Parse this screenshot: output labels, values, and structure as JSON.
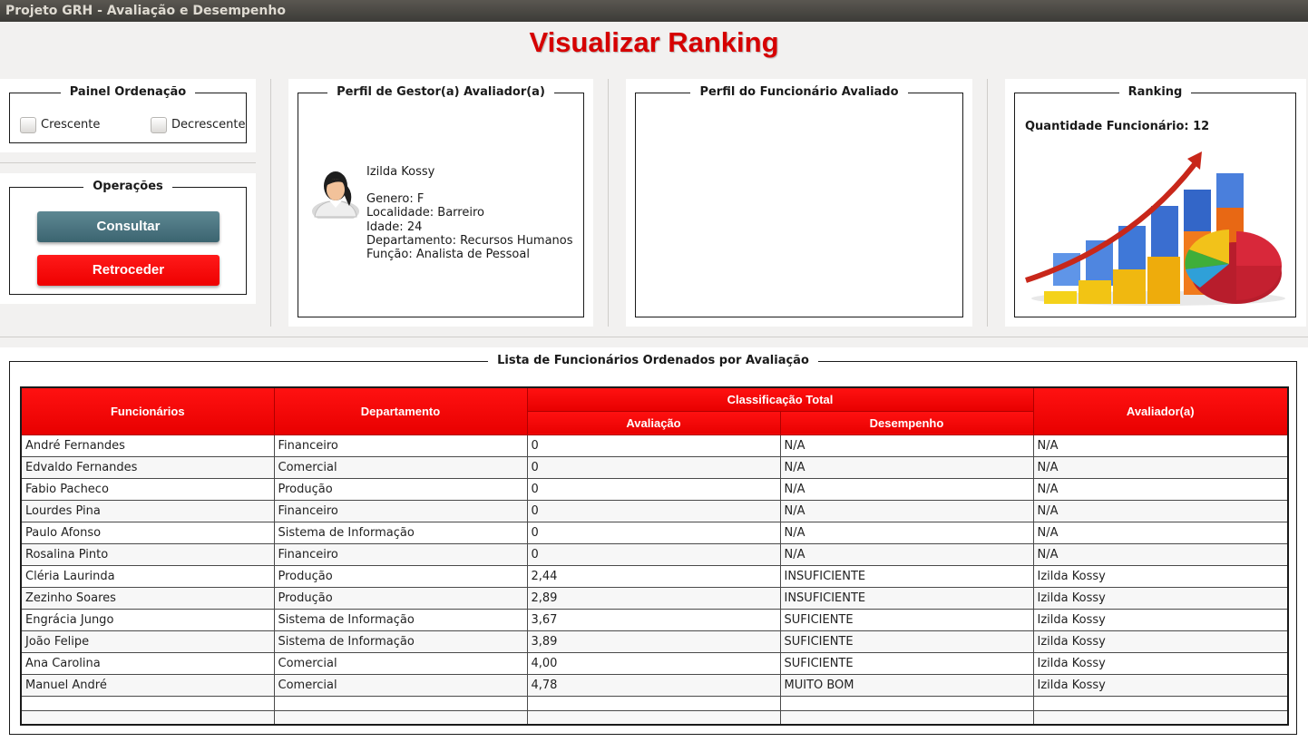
{
  "window": {
    "title": "Projeto GRH - Avaliação e Desempenho"
  },
  "page": {
    "title": "Visualizar Ranking"
  },
  "ordenacao": {
    "legend": "Painel Ordenação",
    "crescente": "Crescente",
    "decrescente": "Decrescente"
  },
  "operacoes": {
    "legend": "Operações",
    "consultar": "Consultar",
    "retroceder": "Retroceder"
  },
  "gestor": {
    "legend": "Perfil de Gestor(a) Avaliador(a)",
    "nome": "Izilda Kossy",
    "genero": "Genero: F",
    "localidade": "Localidade: Barreiro",
    "idade": "Idade: 24",
    "departamento": "Departamento: Recursos Humanos",
    "funcao": "Função: Analista de Pessoal",
    "avatar_icon": "female-user-avatar-icon"
  },
  "funcionario": {
    "legend": "Perfil do Funcionário Avaliado"
  },
  "ranking": {
    "legend": "Ranking",
    "quantidade": "Quantidade Funcionário: 12",
    "image_icon": "ranking-chart-illustration-icon"
  },
  "lista": {
    "legend": "Lista de Funcionários Ordenados por Avaliação",
    "headers": {
      "funcionarios": "Funcionários",
      "departamento": "Departamento",
      "classificacao": "Classificação Total",
      "avaliacao": "Avaliação",
      "desempenho": "Desempenho",
      "avaliador": "Avaliador(a)"
    },
    "rows": [
      [
        "André Fernandes",
        "Financeiro",
        "0",
        "N/A",
        "N/A"
      ],
      [
        "Edvaldo Fernandes",
        "Comercial",
        "0",
        "N/A",
        "N/A"
      ],
      [
        "Fabio Pacheco",
        "Produção",
        "0",
        "N/A",
        "N/A"
      ],
      [
        "Lourdes Pina",
        "Financeiro",
        "0",
        "N/A",
        "N/A"
      ],
      [
        "Paulo Afonso",
        "Sistema de Informação",
        "0",
        "N/A",
        "N/A"
      ],
      [
        "Rosalina Pinto",
        "Financeiro",
        "0",
        "N/A",
        "N/A"
      ],
      [
        "Cléria Laurinda",
        "Produção",
        "2,44",
        "INSUFICIENTE",
        "Izilda Kossy"
      ],
      [
        "Zezinho Soares",
        "Produção",
        "2,89",
        "INSUFICIENTE",
        "Izilda Kossy"
      ],
      [
        "Engrácia Jungo",
        "Sistema de Informação",
        "3,67",
        "SUFICIENTE",
        "Izilda Kossy"
      ],
      [
        "João Felipe",
        "Sistema de Informação",
        "3,89",
        "SUFICIENTE",
        "Izilda Kossy"
      ],
      [
        "Ana Carolina",
        "Comercial",
        "4,00",
        "SUFICIENTE",
        "Izilda Kossy"
      ],
      [
        "Manuel André",
        "Comercial",
        "4,78",
        "MUITO BOM",
        "Izilda Kossy"
      ],
      [
        "",
        "",
        "",
        "",
        ""
      ],
      [
        "",
        "",
        "",
        "",
        ""
      ]
    ]
  },
  "colors": {
    "title_red": "#d60000",
    "header_red": "#ff0000",
    "consultar_teal": "#4a7480"
  }
}
